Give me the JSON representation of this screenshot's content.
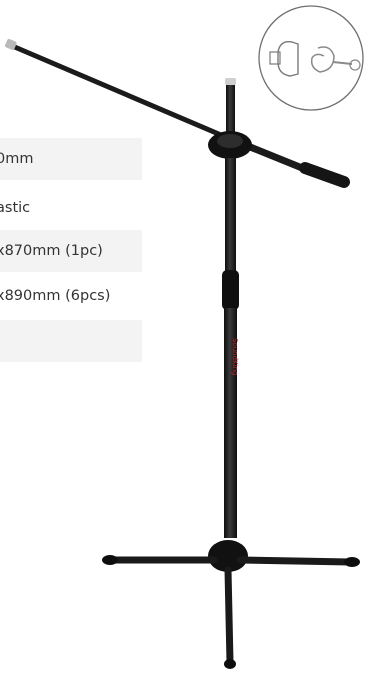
{
  "spec_rows": [
    {
      "value": "0mm",
      "shaded": true
    },
    {
      "value": "astic",
      "shaded": false
    },
    {
      "value": "x870mm (1pc)",
      "shaded": true
    },
    {
      "value": "x890mm (6pcs)",
      "shaded": false
    },
    {
      "value": "",
      "shaded": true
    }
  ],
  "product": {
    "stand_brand_text": "SoundKing"
  },
  "colors": {
    "stand": "#1b1b1b",
    "row_shade": "#f3f3f3",
    "text": "#333333",
    "accent_red": "#c0272d",
    "inset_stroke": "#7a7a7a"
  }
}
